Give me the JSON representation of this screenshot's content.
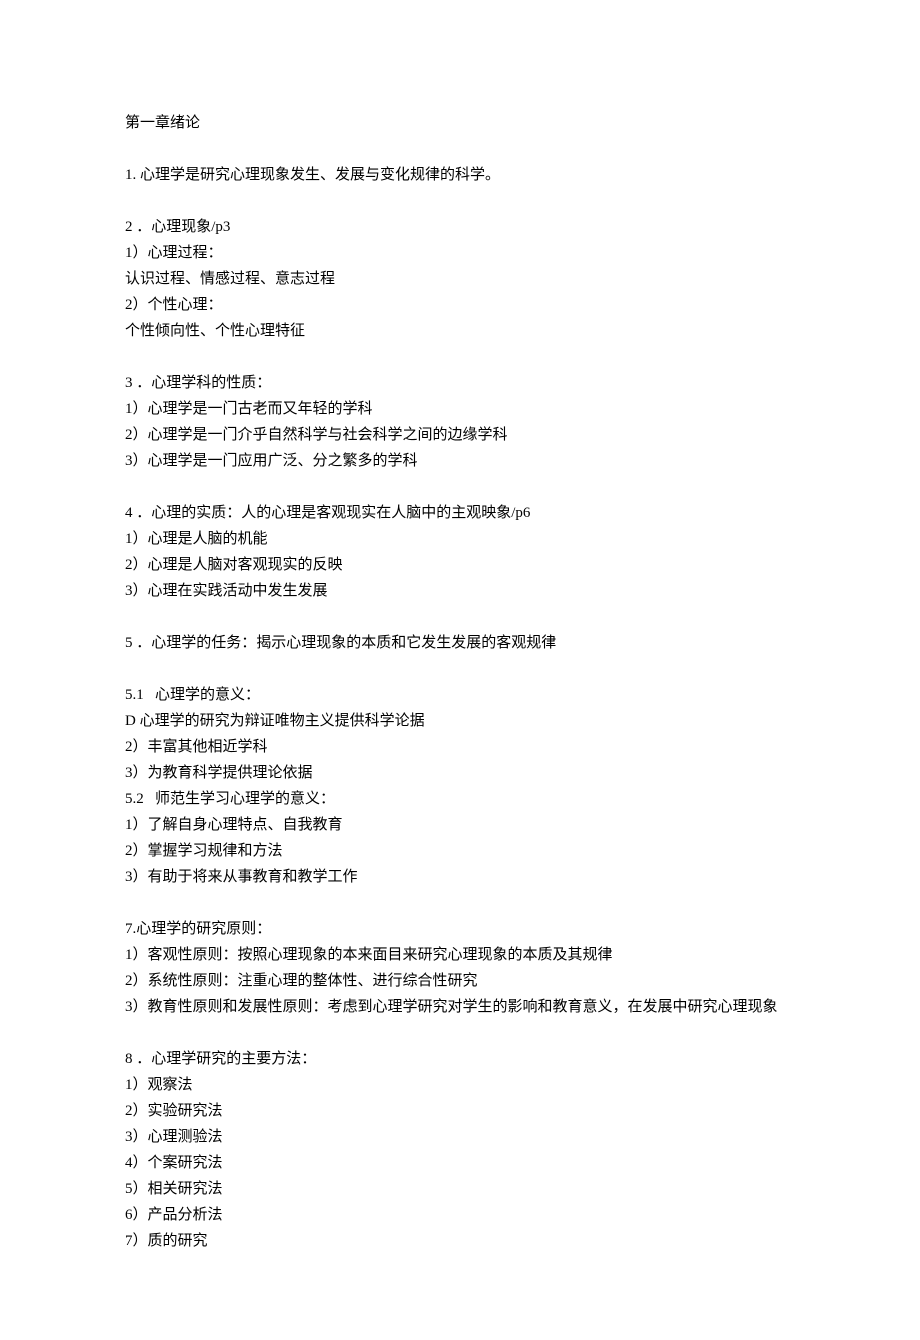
{
  "title": "第一章绪论",
  "sections": [
    {
      "lines": [
        "1. 心理学是研究心理现象发生、发展与变化规律的科学。"
      ]
    },
    {
      "lines": [
        "2 ．心理现象/p3",
        "1）心理过程：",
        "认识过程、情感过程、意志过程",
        "2）个性心理：",
        "个性倾向性、个性心理特征"
      ]
    },
    {
      "lines": [
        "3 ．心理学科的性质：",
        "1）心理学是一门古老而又年轻的学科",
        "2）心理学是一门介乎自然科学与社会科学之间的边缘学科",
        "3）心理学是一门应用广泛、分之繁多的学科"
      ]
    },
    {
      "lines": [
        "4 ．心理的实质：人的心理是客观现实在人脑中的主观映象/p6",
        "1）心理是人脑的机能",
        "2）心理是人脑对客观现实的反映",
        "3）心理在实践活动中发生发展"
      ]
    },
    {
      "lines": [
        "5 ．心理学的任务：揭示心理现象的本质和它发生发展的客观规律"
      ]
    },
    {
      "lines": [
        "5.1   心理学的意义：",
        "D 心理学的研究为辩证唯物主义提供科学论据",
        "2）丰富其他相近学科",
        "3）为教育科学提供理论依据",
        "5.2   师范生学习心理学的意义：",
        "1）了解自身心理特点、自我教育",
        "2）掌握学习规律和方法",
        "3）有助于将来从事教育和教学工作"
      ]
    },
    {
      "lines": [
        "7.心理学的研究原则：",
        "1）客观性原则：按照心理现象的本来面目来研究心理现象的本质及其规律",
        "2）系统性原则：注重心理的整体性、进行综合性研究",
        "3）教育性原则和发展性原则：考虑到心理学研究对学生的影响和教育意义，在发展中研究心理现象"
      ]
    },
    {
      "lines": [
        "8 ．心理学研究的主要方法：",
        "1）观察法",
        "2）实验研究法",
        "3）心理测验法",
        "4）个案研究法",
        "5）相关研究法",
        "6）产品分析法",
        "7）质的研究"
      ]
    }
  ]
}
